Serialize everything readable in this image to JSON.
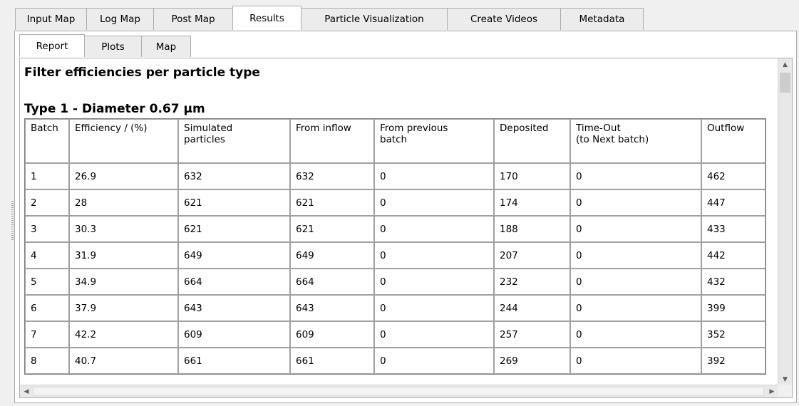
{
  "main_tabs": [
    {
      "label": "Input Map",
      "active": false
    },
    {
      "label": "Log Map",
      "active": false
    },
    {
      "label": "Post Map",
      "active": false
    },
    {
      "label": "Results",
      "active": true
    },
    {
      "label": "Particle Visualization",
      "active": false
    },
    {
      "label": "Create Videos",
      "active": false
    },
    {
      "label": "Metadata",
      "active": false
    }
  ],
  "sub_tabs": [
    {
      "label": "Report",
      "active": true
    },
    {
      "label": "Plots",
      "active": false
    },
    {
      "label": "Map",
      "active": false
    }
  ],
  "report": {
    "title": "Filter efficiencies per particle type",
    "type_heading": "Type 1 - Diameter 0.67 µm",
    "columns": [
      {
        "l1": "Batch",
        "l2": ""
      },
      {
        "l1": "Efficiency / (%)",
        "l2": ""
      },
      {
        "l1": "Simulated",
        "l2": "particles"
      },
      {
        "l1": "From inflow",
        "l2": ""
      },
      {
        "l1": "From previous",
        "l2": "batch"
      },
      {
        "l1": "Deposited",
        "l2": ""
      },
      {
        "l1": "Time-Out",
        "l2": "(to Next batch)"
      },
      {
        "l1": "Outflow",
        "l2": ""
      }
    ],
    "rows": [
      [
        "1",
        "26.9",
        "632",
        "632",
        "0",
        "170",
        "0",
        "462"
      ],
      [
        "2",
        "28",
        "621",
        "621",
        "0",
        "174",
        "0",
        "447"
      ],
      [
        "3",
        "30.3",
        "621",
        "621",
        "0",
        "188",
        "0",
        "433"
      ],
      [
        "4",
        "31.9",
        "649",
        "649",
        "0",
        "207",
        "0",
        "442"
      ],
      [
        "5",
        "34.9",
        "664",
        "664",
        "0",
        "232",
        "0",
        "432"
      ],
      [
        "6",
        "37.9",
        "643",
        "643",
        "0",
        "244",
        "0",
        "399"
      ],
      [
        "7",
        "42.2",
        "609",
        "609",
        "0",
        "257",
        "0",
        "352"
      ],
      [
        "8",
        "40.7",
        "661",
        "661",
        "0",
        "269",
        "0",
        "392"
      ]
    ]
  },
  "scrollbars": {
    "up_icon": "scroll-up-arrow",
    "down_icon": "scroll-down-arrow",
    "left_icon": "scroll-left-arrow",
    "right_icon": "scroll-right-arrow"
  }
}
